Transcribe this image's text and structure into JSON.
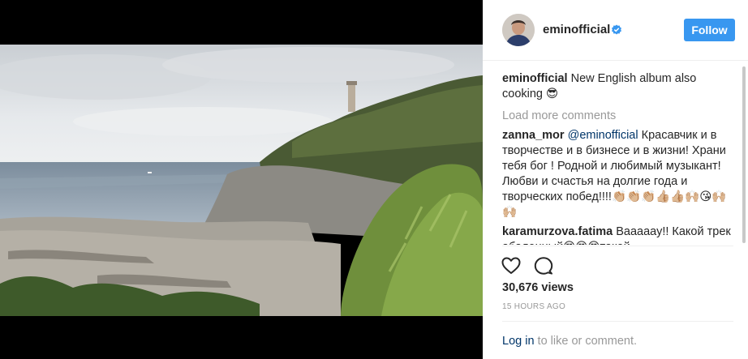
{
  "post": {
    "username": "eminofficial",
    "follow_label": "Follow",
    "caption_author": "eminofficial",
    "caption_text": "New English album also cooking 😎",
    "load_more": "Load more comments",
    "comments": [
      {
        "author": "zanna_mor",
        "mention": "@eminofficial",
        "text": "Красавчик и в творчестве и в бизнесе и в жизни! Храни тебя бог ! Родной и любимый музыкант! Любви и счастья на долгие года и творческих побед!!!!👏🏼👏🏼👏🏼👍🏼👍🏼🙌🏼😘🙌🏼🙌🏼"
      },
      {
        "author": "karamurzova.fatima",
        "mention": "",
        "text": "Вааааау!! Какой трек абаленный😍😍😍такой"
      }
    ],
    "views": "30,676 views",
    "time_ago": "15 HOURS AGO",
    "login_link": "Log in",
    "login_suffix": " to like or comment."
  },
  "icons": {
    "verified": "verified-badge-icon",
    "like": "heart-icon",
    "comment": "comment-icon"
  },
  "colors": {
    "accent": "#3897f0",
    "link": "#003569",
    "muted": "#999999",
    "text": "#262626"
  }
}
